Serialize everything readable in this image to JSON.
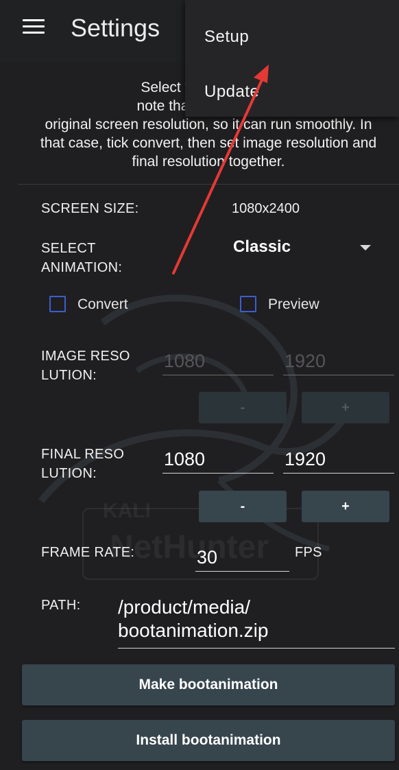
{
  "appbar": {
    "title": "Settings",
    "menu_icon": "hamburger-menu-icon"
  },
  "overflow_menu": {
    "items": [
      {
        "label": "Setup"
      },
      {
        "label": "Update"
      }
    ]
  },
  "intro": {
    "line1": "Select your desired b",
    "line2": "note that some older p",
    "line3": "original screen resolution, so it can run smoothly. In",
    "line4": "that case, tick convert, then set image resolution and",
    "line5": "final resolution together."
  },
  "screen_size": {
    "label": "SCREEN SIZE:",
    "value": "1080x2400"
  },
  "animation": {
    "label_line1": "SELECT",
    "label_line2": "ANIMATION:",
    "selected": "Classic"
  },
  "options": {
    "convert_label": "Convert",
    "convert_checked": false,
    "preview_label": "Preview",
    "preview_checked": false
  },
  "image_resolution": {
    "label_line1": "IMAGE RESO",
    "label_line2": "LUTION:",
    "width_placeholder": "1080",
    "height_placeholder": "1920",
    "minus": "-",
    "plus": "+"
  },
  "final_resolution": {
    "label_line1": "FINAL RESO",
    "label_line2": "LUTION:",
    "width": "1080",
    "height": "1920",
    "minus": "-",
    "plus": "+"
  },
  "frame_rate": {
    "label": "FRAME RATE:",
    "value": "30",
    "unit": "FPS"
  },
  "path": {
    "label": "PATH:",
    "line1": "/product/media/",
    "line2": "bootanimation.zip"
  },
  "actions": {
    "make": "Make bootanimation",
    "install": "Install bootanimation"
  },
  "watermark": {
    "small": "KALI",
    "big": "NetHunter"
  },
  "colors": {
    "background": "#1f1f21",
    "button": "#37454d",
    "checkbox": "#3d5ecf",
    "annotation": "#e53935"
  }
}
